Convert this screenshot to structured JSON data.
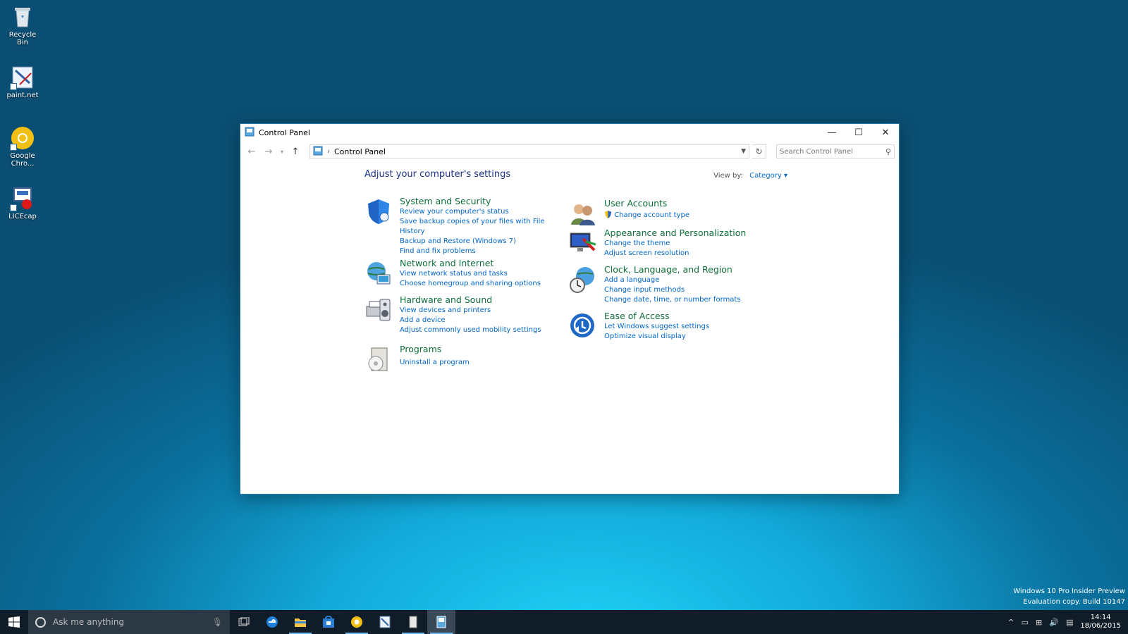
{
  "desktop": {
    "icons": [
      {
        "label": "Recycle Bin",
        "icon": "recycle-bin-icon"
      },
      {
        "label": "paint.net",
        "icon": "paintnet-icon"
      },
      {
        "label": "Google Chro...",
        "icon": "chrome-icon"
      },
      {
        "label": "LICEcap",
        "icon": "licecap-icon"
      }
    ]
  },
  "window": {
    "title": "Control Panel",
    "address": {
      "crumb": "Control Panel"
    },
    "search_placeholder": "Search Control Panel",
    "heading": "Adjust your computer's settings",
    "view_by_label": "View by:",
    "view_by_value": "Category",
    "categories_left": [
      {
        "title": "System and Security",
        "icon": "shield-icon",
        "links": [
          "Review your computer's status",
          "Save backup copies of your files with File History",
          "Backup and Restore (Windows 7)",
          "Find and fix problems"
        ]
      },
      {
        "title": "Network and Internet",
        "icon": "network-globe-icon",
        "links": [
          "View network status and tasks",
          "Choose homegroup and sharing options"
        ]
      },
      {
        "title": "Hardware and Sound",
        "icon": "printer-speaker-icon",
        "links": [
          "View devices and printers",
          "Add a device",
          "Adjust commonly used mobility settings"
        ]
      },
      {
        "title": "Programs",
        "icon": "programs-disc-icon",
        "links": [
          "Uninstall a program"
        ]
      }
    ],
    "categories_right": [
      {
        "title": "User Accounts",
        "icon": "users-icon",
        "links": [
          "Change account type"
        ]
      },
      {
        "title": "Appearance and Personalization",
        "icon": "monitor-palette-icon",
        "links": [
          "Change the theme",
          "Adjust screen resolution"
        ]
      },
      {
        "title": "Clock, Language, and Region",
        "icon": "clock-globe-icon",
        "links": [
          "Add a language",
          "Change input methods",
          "Change date, time, or number formats"
        ]
      },
      {
        "title": "Ease of Access",
        "icon": "ease-of-access-icon",
        "links": [
          "Let Windows suggest settings",
          "Optimize visual display"
        ]
      }
    ]
  },
  "taskbar": {
    "search_text": "Ask me anything",
    "apps": [
      "task-view-icon",
      "edge-icon",
      "file-explorer-icon",
      "store-icon",
      "chrome-icon",
      "paintnet-icon",
      "licecap-icon",
      "control-panel-icon"
    ],
    "time": "14:14",
    "date": "18/06/2015"
  },
  "watermark": {
    "line1": "Windows 10 Pro Insider Preview",
    "line2": "Evaluation copy. Build 10147"
  },
  "colors": {
    "category_title": "#0f6e3a",
    "link": "#0066cc",
    "heading": "#1e3287",
    "taskbar": "#101c28"
  }
}
